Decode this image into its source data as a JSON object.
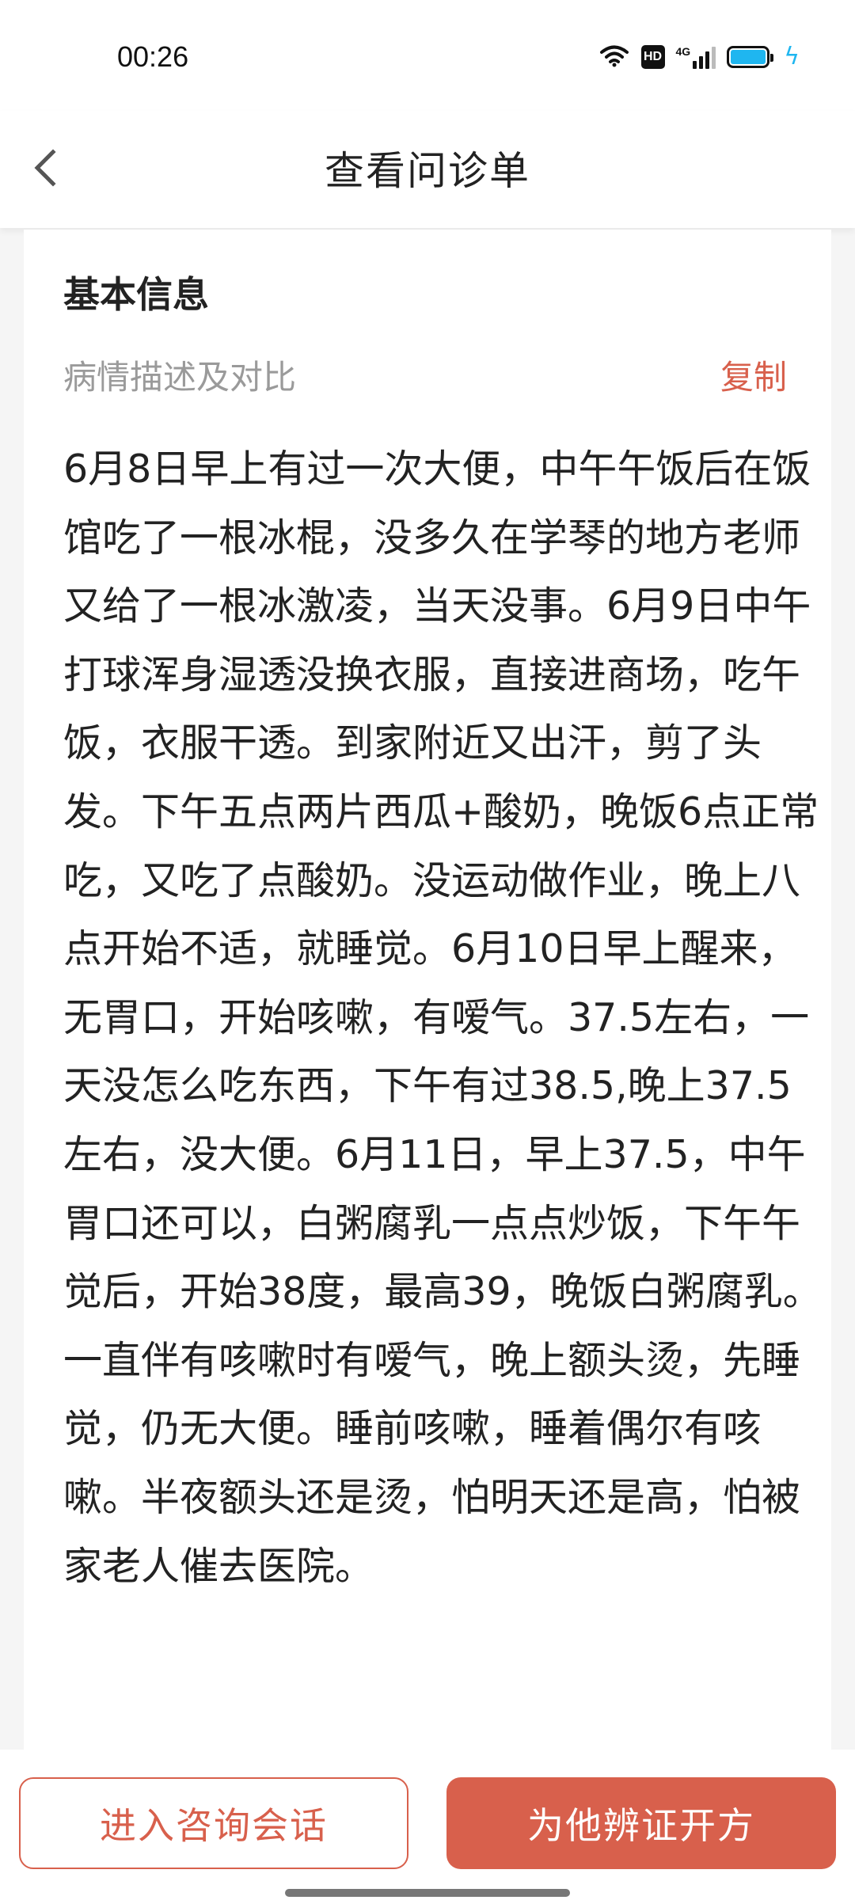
{
  "status_bar": {
    "time": "00:26",
    "hd_label": "HD",
    "network_label": "4G",
    "battery_level": 1.0,
    "accent_color": "#1fb6f0"
  },
  "header": {
    "title": "查看问诊单",
    "back_icon": "back-arrow-icon"
  },
  "card": {
    "section_title": "基本信息",
    "description_label": "病情描述及对比",
    "copy_label": "复制",
    "description_text": "6月8日早上有过一次大便，中午午饭后在饭馆吃了一根冰棍，没多久在学琴的地方老师又给了一根冰激凌，当天没事。6月9日中午打球浑身湿透没换衣服，直接进商场，吃午饭，衣服干透。到家附近又出汗，剪了头发。下午五点两片西瓜+酸奶，晚饭6点正常吃，又吃了点酸奶。没运动做作业，晚上八点开始不适，就睡觉。6月10日早上醒来，无胃口，开始咳嗽，有嗳气。37.5左右，一天没怎么吃东西，下午有过38.5,晚上37.5左右，没大便。6月11日，早上37.5，中午胃口还可以，白粥腐乳一点点炒饭，下午午觉后，开始38度，最高39，晚饭白粥腐乳。一直伴有咳嗽时有嗳气，晚上额头烫，先睡觉，仍无大便。睡前咳嗽，睡着偶尔有咳嗽。半夜额头还是烫，怕明天还是高，怕被家老人催去医院。"
  },
  "bottom_bar": {
    "consult_button_label": "进入咨询会话",
    "prescribe_button_label": "为他辨证开方",
    "brand_color": "#d8604c"
  }
}
